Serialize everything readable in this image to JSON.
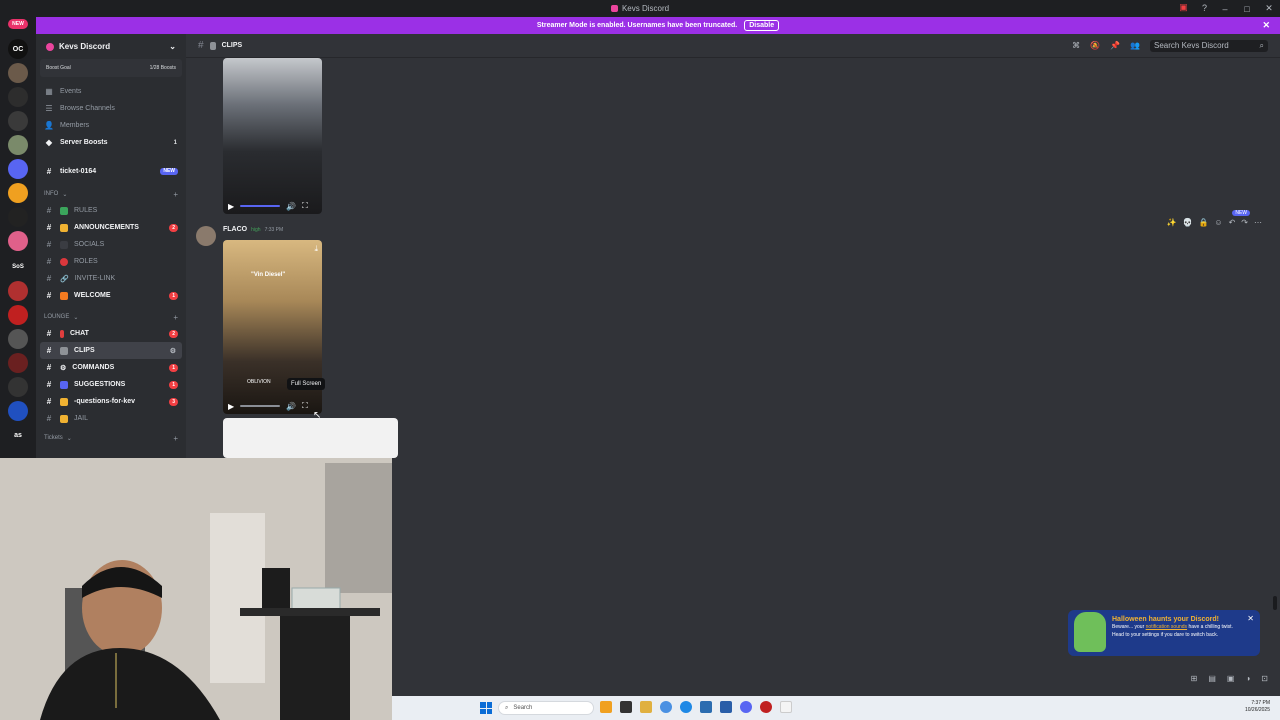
{
  "window": {
    "title": "Kevs Discord"
  },
  "banner": {
    "text": "Streamer Mode is enabled. Usernames have been truncated.",
    "button": "Disable"
  },
  "server": {
    "name": "Kevs Discord",
    "boost_goal": "Boost Goal",
    "boost_count": "1/28 Boosts"
  },
  "sidebar": {
    "top_items": [
      {
        "label": "Events",
        "icon": "calendar-icon"
      },
      {
        "label": "Browse Channels",
        "icon": "browse-icon"
      },
      {
        "label": "Members",
        "icon": "members-icon"
      },
      {
        "label": "Server Boosts",
        "icon": "boost-icon",
        "count": "1"
      }
    ],
    "ticket": {
      "label": "ticket-0164",
      "badge": "NEW"
    },
    "category_info": "INFO",
    "info_channels": [
      {
        "label": "RULES",
        "bold": false
      },
      {
        "label": "ANNOUNCEMENTS",
        "bold": true,
        "badge": "2"
      },
      {
        "label": "SOCIALS",
        "bold": false
      },
      {
        "label": "ROLES",
        "bold": false
      },
      {
        "label": "INVITE-LINK",
        "bold": false
      },
      {
        "label": "WELCOME",
        "bold": true,
        "badge": "1"
      }
    ],
    "category_lounge": "LOUNGE",
    "lounge_channels": [
      {
        "label": "CHAT",
        "bold": true,
        "badge": "2"
      },
      {
        "label": "CLIPS",
        "bold": true,
        "selected": true
      },
      {
        "label": "COMMANDS",
        "bold": true,
        "badge": "1"
      },
      {
        "label": "SUGGESTIONS",
        "bold": true,
        "badge": "1"
      },
      {
        "label": "-questions-for-kev",
        "bold": true,
        "badge": "3"
      },
      {
        "label": "JAIL",
        "bold": false
      }
    ],
    "category_tickets": "Tickets"
  },
  "rail": {
    "servers": [
      "OC",
      "",
      "",
      "",
      "",
      "",
      "",
      "",
      "",
      "SoS",
      "",
      "",
      "",
      "",
      "",
      "",
      "",
      "as"
    ],
    "new_badge": "NEW"
  },
  "header": {
    "channel": "CLIPS",
    "search_placeholder": "Search Kevs Discord"
  },
  "message": {
    "user": "FLACO",
    "tag": "high",
    "time": "7:33 PM",
    "video_caption": "\"Vin Diesel\"",
    "video_watermark": "OBLIVION",
    "tooltip": "Full Screen",
    "new_label": "NEW"
  },
  "notification": {
    "title": "Halloween haunts your Discord!",
    "body_1": "Beware... your",
    "link": "notification sounds",
    "body_2": "have a chilling twist.",
    "body_3": "Head to your settings if you dare to switch back."
  },
  "taskbar": {
    "search": "Search",
    "time": "7:37 PM",
    "date": "10/26/2025"
  },
  "colors": {
    "accent": "#5865f2",
    "banner": "#9b30e6",
    "alert": "#f23f43"
  }
}
